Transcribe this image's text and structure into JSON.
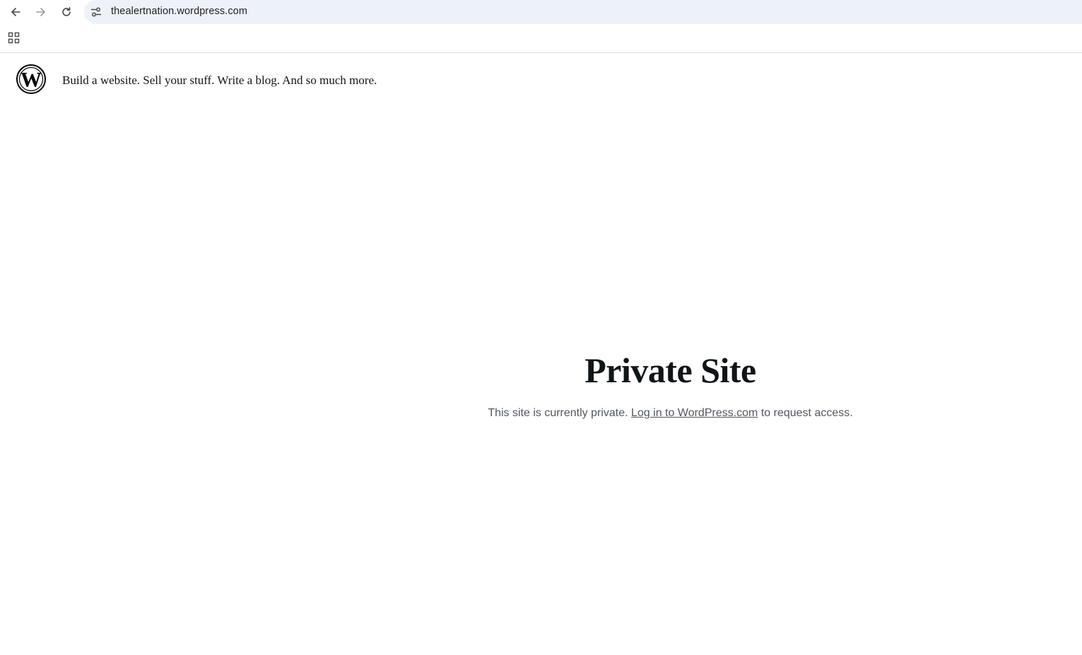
{
  "browser": {
    "url": "thealertnation.wordpress.com",
    "icons": {
      "back": "arrow-left-icon",
      "forward": "arrow-right-icon",
      "reload": "reload-icon",
      "site_info": "tune-icon",
      "apps": "apps-grid-icon"
    }
  },
  "header": {
    "logo": "wordpress-logo",
    "tagline": "Build a website. Sell your stuff. Write a blog. And so much more."
  },
  "main": {
    "title": "Private Site",
    "desc_before": "This site is currently private.",
    "link_text": "Log in to WordPress.com",
    "desc_after": "to request access."
  },
  "colors": {
    "omnibox_bg": "#edf2fa",
    "text_dark": "#101517",
    "text_muted": "#50575e"
  }
}
